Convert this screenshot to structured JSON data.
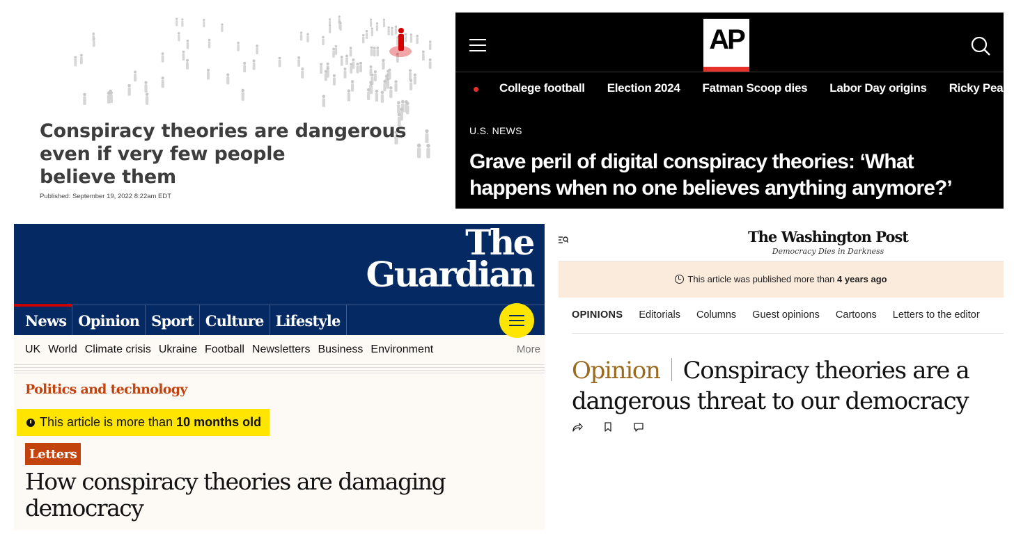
{
  "conversation": {
    "headline_lines": [
      "Conspiracy theories are dangerous",
      "even if very few people",
      "believe them"
    ],
    "published": "Published: September 19, 2022 8:22am EDT",
    "colors": {
      "text": "#3d3d3d",
      "highlight_figure": "#d40000"
    }
  },
  "ap": {
    "logo": "AP",
    "trending": [
      "College football",
      "Election 2024",
      "Fatman Scoop dies",
      "Labor Day origins",
      "Ricky Pearsall"
    ],
    "kicker": "U.S. NEWS",
    "headline": "Grave peril of digital conspiracy theories: ‘What happens when no one believes anything anymore?’",
    "icons": [
      "hamburger-menu-icon",
      "search-icon"
    ],
    "colors": {
      "background": "#000000",
      "accent": "#e5322d"
    }
  },
  "guardian": {
    "wordmark_line1": "The",
    "wordmark_line2": "Guardian",
    "pillars": [
      "News",
      "Opinion",
      "Sport",
      "Culture",
      "Lifestyle"
    ],
    "subnav": [
      "UK",
      "World",
      "Climate crisis",
      "Ukraine",
      "Football",
      "Newsletters",
      "Business",
      "Environment"
    ],
    "more": "More",
    "series": "Politics and technology",
    "age_prefix": "This article is more than ",
    "age_value": "10 months old",
    "tag": "Letters",
    "headline": "How conspiracy theories are damaging democracy",
    "colors": {
      "brand": "#052962",
      "accent": "#c2430e",
      "highlight": "#ffe500"
    }
  },
  "wapo": {
    "masthead": "The Washington Post",
    "tagline": "Democracy Dies in Darkness",
    "notice_prefix": "This article was published more than ",
    "notice_value": "4 years ago",
    "section": "OPINIONS",
    "section_links": [
      "Editorials",
      "Columns",
      "Guest opinions",
      "Cartoons",
      "Letters to the editor"
    ],
    "label": "Opinion",
    "headline": "Conspiracy theories are a dangerous threat to our democracy",
    "icons": [
      "search-icon",
      "share-icon",
      "bookmark-icon",
      "comment-icon"
    ],
    "colors": {
      "notice_bg": "#fbebdd",
      "label": "#9a6b1f"
    }
  }
}
